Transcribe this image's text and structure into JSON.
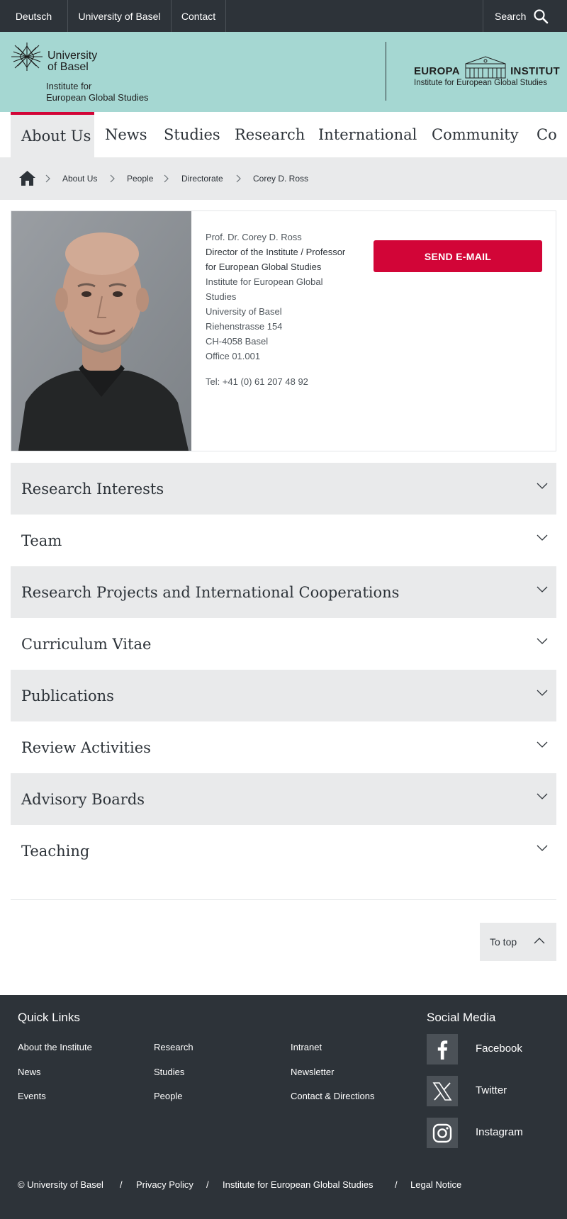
{
  "topbar": {
    "links": [
      "Deutsch",
      "University of Basel",
      "Contact"
    ],
    "search_label": "Search"
  },
  "header": {
    "university_line1": "University",
    "university_line2": "of Basel",
    "institute_line1": "Institute for",
    "institute_line2": "European Global Studies",
    "europa_left": "EUROPA",
    "europa_right": "INSTITUT",
    "europa_sub": "Institute for European Global Studies"
  },
  "nav": {
    "items": [
      "About Us",
      "News",
      "Studies",
      "Research",
      "International",
      "Community",
      "Co"
    ],
    "active": "About Us"
  },
  "breadcrumb": [
    "About Us",
    "People",
    "Directorate",
    "Corey D. Ross"
  ],
  "profile": {
    "name": "Prof. Dr. Corey D. Ross",
    "role_line1": "Director of the Institute / Professor",
    "role_line2": "for European Global Studies",
    "inst_line1": "Institute for European Global",
    "inst_line2": "Studies",
    "university": "University of Basel",
    "street": "Riehenstrasse 154",
    "city": "CH-4058 Basel",
    "office": "Office 01.001",
    "tel": "Tel: +41 (0) 61 207 48 92",
    "send_button": "SEND E-MAIL"
  },
  "accordion": [
    "Research Interests",
    "Team",
    "Research Projects and International Cooperations",
    "Curriculum Vitae",
    "Publications",
    "Review Activities",
    "Advisory Boards",
    "Teaching"
  ],
  "to_top": "To top",
  "footer": {
    "quick_links_title": "Quick Links",
    "col1": [
      "About the Institute",
      "News",
      "Events"
    ],
    "col2": [
      "Research",
      "Studies",
      "People"
    ],
    "col3": [
      "Intranet",
      "Newsletter",
      "Contact & Directions"
    ],
    "social_title": "Social Media",
    "social": [
      "Facebook",
      "Twitter",
      "Instagram"
    ],
    "legal": [
      "© University of Basel",
      "Privacy Policy",
      "Institute for European Global Studies",
      "Legal Notice"
    ],
    "legal_separator": "/"
  },
  "colors": {
    "dark": "#2d3339",
    "mint": "#a5d7d2",
    "accent": "#d20537",
    "light_gray": "#e9eaeb"
  }
}
